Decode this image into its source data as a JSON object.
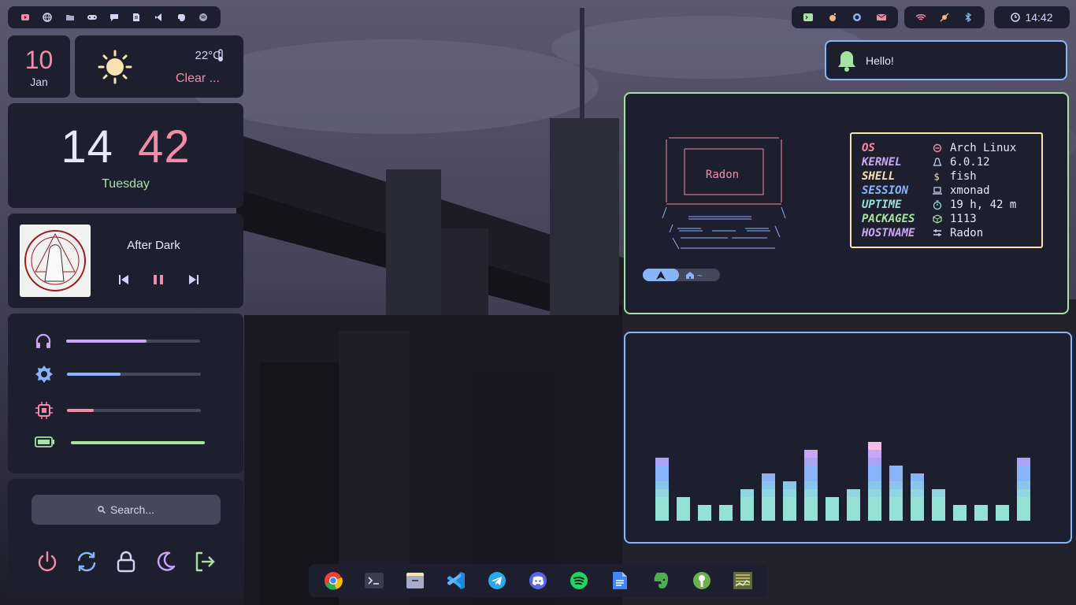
{
  "topbar_left": {
    "icons": [
      "youtube-icon",
      "globe-icon",
      "folder-icon",
      "gamepad-icon",
      "chat-icon",
      "document-icon",
      "vscode-icon",
      "evernote-icon",
      "spotify-icon"
    ]
  },
  "topbar_right": {
    "apps": [
      "terminal-icon",
      "reddit-icon",
      "github-icon",
      "mail-icon"
    ],
    "status": [
      "wifi-icon",
      "sun-off-icon",
      "bluetooth-icon"
    ],
    "clock": "14:42"
  },
  "date": {
    "day": "10",
    "month": "Jan"
  },
  "weather": {
    "temp": "22°C",
    "condition": "Clear ..."
  },
  "clock": {
    "hour": "14",
    "minute": "42",
    "weekday": "Tuesday"
  },
  "music": {
    "title": "After Dark",
    "state": "paused"
  },
  "sliders": [
    {
      "name": "volume",
      "icon": "headphones-icon",
      "value": 0.6,
      "color": "#cba6f7"
    },
    {
      "name": "brightness",
      "icon": "brightness-icon",
      "value": 0.4,
      "color": "#89b4fa"
    },
    {
      "name": "cpu",
      "icon": "cpu-icon",
      "value": 0.2,
      "color": "#f38ba8"
    },
    {
      "name": "battery",
      "icon": "battery-icon",
      "value": 1.0,
      "color": "#a6e3a1"
    }
  ],
  "search": {
    "placeholder": "Search..."
  },
  "power": [
    "power-icon",
    "reboot-icon",
    "lock-icon",
    "sleep-icon",
    "logout-icon"
  ],
  "notification": {
    "text": "Hello!"
  },
  "fetch": {
    "ascii_name": "Radon",
    "prompt_path": "~",
    "rows": [
      {
        "key": "OS",
        "value": "Arch Linux",
        "keycolor": "#f38ba8",
        "icon": "arch-icon"
      },
      {
        "key": "KERNEL",
        "value": "6.0.12",
        "keycolor": "#cba6f7",
        "icon": "tux-icon"
      },
      {
        "key": "SHELL",
        "value": "fish",
        "keycolor": "#f9e2af",
        "icon": "dollar-icon"
      },
      {
        "key": "SESSION",
        "value": "xmonad",
        "keycolor": "#89b4fa",
        "icon": "laptop-icon"
      },
      {
        "key": "UPTIME",
        "value": "19 h, 42 m",
        "keycolor": "#94e2d5",
        "icon": "timer-icon"
      },
      {
        "key": "PACKAGES",
        "value": "1113",
        "keycolor": "#a6e3a1",
        "icon": "package-icon"
      },
      {
        "key": "HOSTNAME",
        "value": "Radon",
        "keycolor": "#cba6f7",
        "icon": "sliders-icon"
      }
    ]
  },
  "visualizer": {
    "levels": [
      8,
      3,
      2,
      2,
      4,
      6,
      5,
      9,
      3,
      4,
      10,
      7,
      6,
      4,
      2,
      2,
      2,
      8
    ]
  },
  "dock": [
    "chrome-icon",
    "terminal-icon",
    "files-icon",
    "vscode-icon",
    "telegram-icon",
    "discord-icon",
    "spotify-icon",
    "docs-icon",
    "evernote-icon",
    "keepass-icon",
    "taskmanager-icon"
  ],
  "colors": {
    "bg": "#1e1f2e",
    "pink": "#f38ba8",
    "green": "#a6e3a1",
    "blue": "#89b4fa",
    "mauve": "#cba6f7",
    "yellow": "#f9e2af"
  }
}
